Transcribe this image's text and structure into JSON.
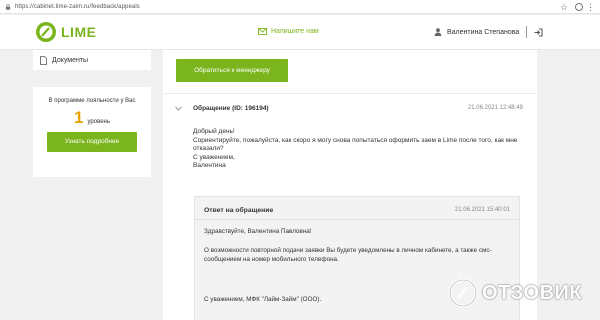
{
  "browser": {
    "url": "https://cabinet.lime-zaim.ru/feedback/appeals",
    "icons": [
      "lock-icon",
      "star-icon",
      "extension-icon",
      "menu-icon"
    ]
  },
  "header": {
    "logo_text": "LIME",
    "write_us": "Напишите нам",
    "user_name": "Валентина Степанова",
    "accent_color": "#7ab51d"
  },
  "sidebar": {
    "documents_label": "Документы",
    "loyalty": {
      "text": "В программе лояльности у Вас",
      "level_number": "1",
      "level_unit": "уровень",
      "button": "Узнать подробнее",
      "level_color": "#e8a300"
    }
  },
  "main": {
    "manager_button": "Обратиться к менеджеру",
    "appeal": {
      "title_prefix": "Обращение",
      "title_id": "(ID: 196194)",
      "datetime": "21.06.2021 12:48:49",
      "message_lines": [
        "Добрый день!",
        "Сориентируйте, пожалуйста, как скоро я могу снова попытаться оформить заем в Lime после того, как мне отказали?",
        "С уважением,",
        "Валентина"
      ]
    },
    "reply": {
      "title": "Ответ на обращение",
      "datetime": "21.06.2021 15:40:01",
      "greeting": "Здравствуйте, Валентина Павловна!",
      "body": "О возможности повторной подачи заявки Вы будете уведомлены в личном кабинете, а также смс-сообщением на номер мобильного телефона.",
      "signature": "С уважением, МФК \"Лайм-Займ\" (ООО)."
    }
  },
  "watermark": {
    "text": "ОТЗОВИК"
  }
}
